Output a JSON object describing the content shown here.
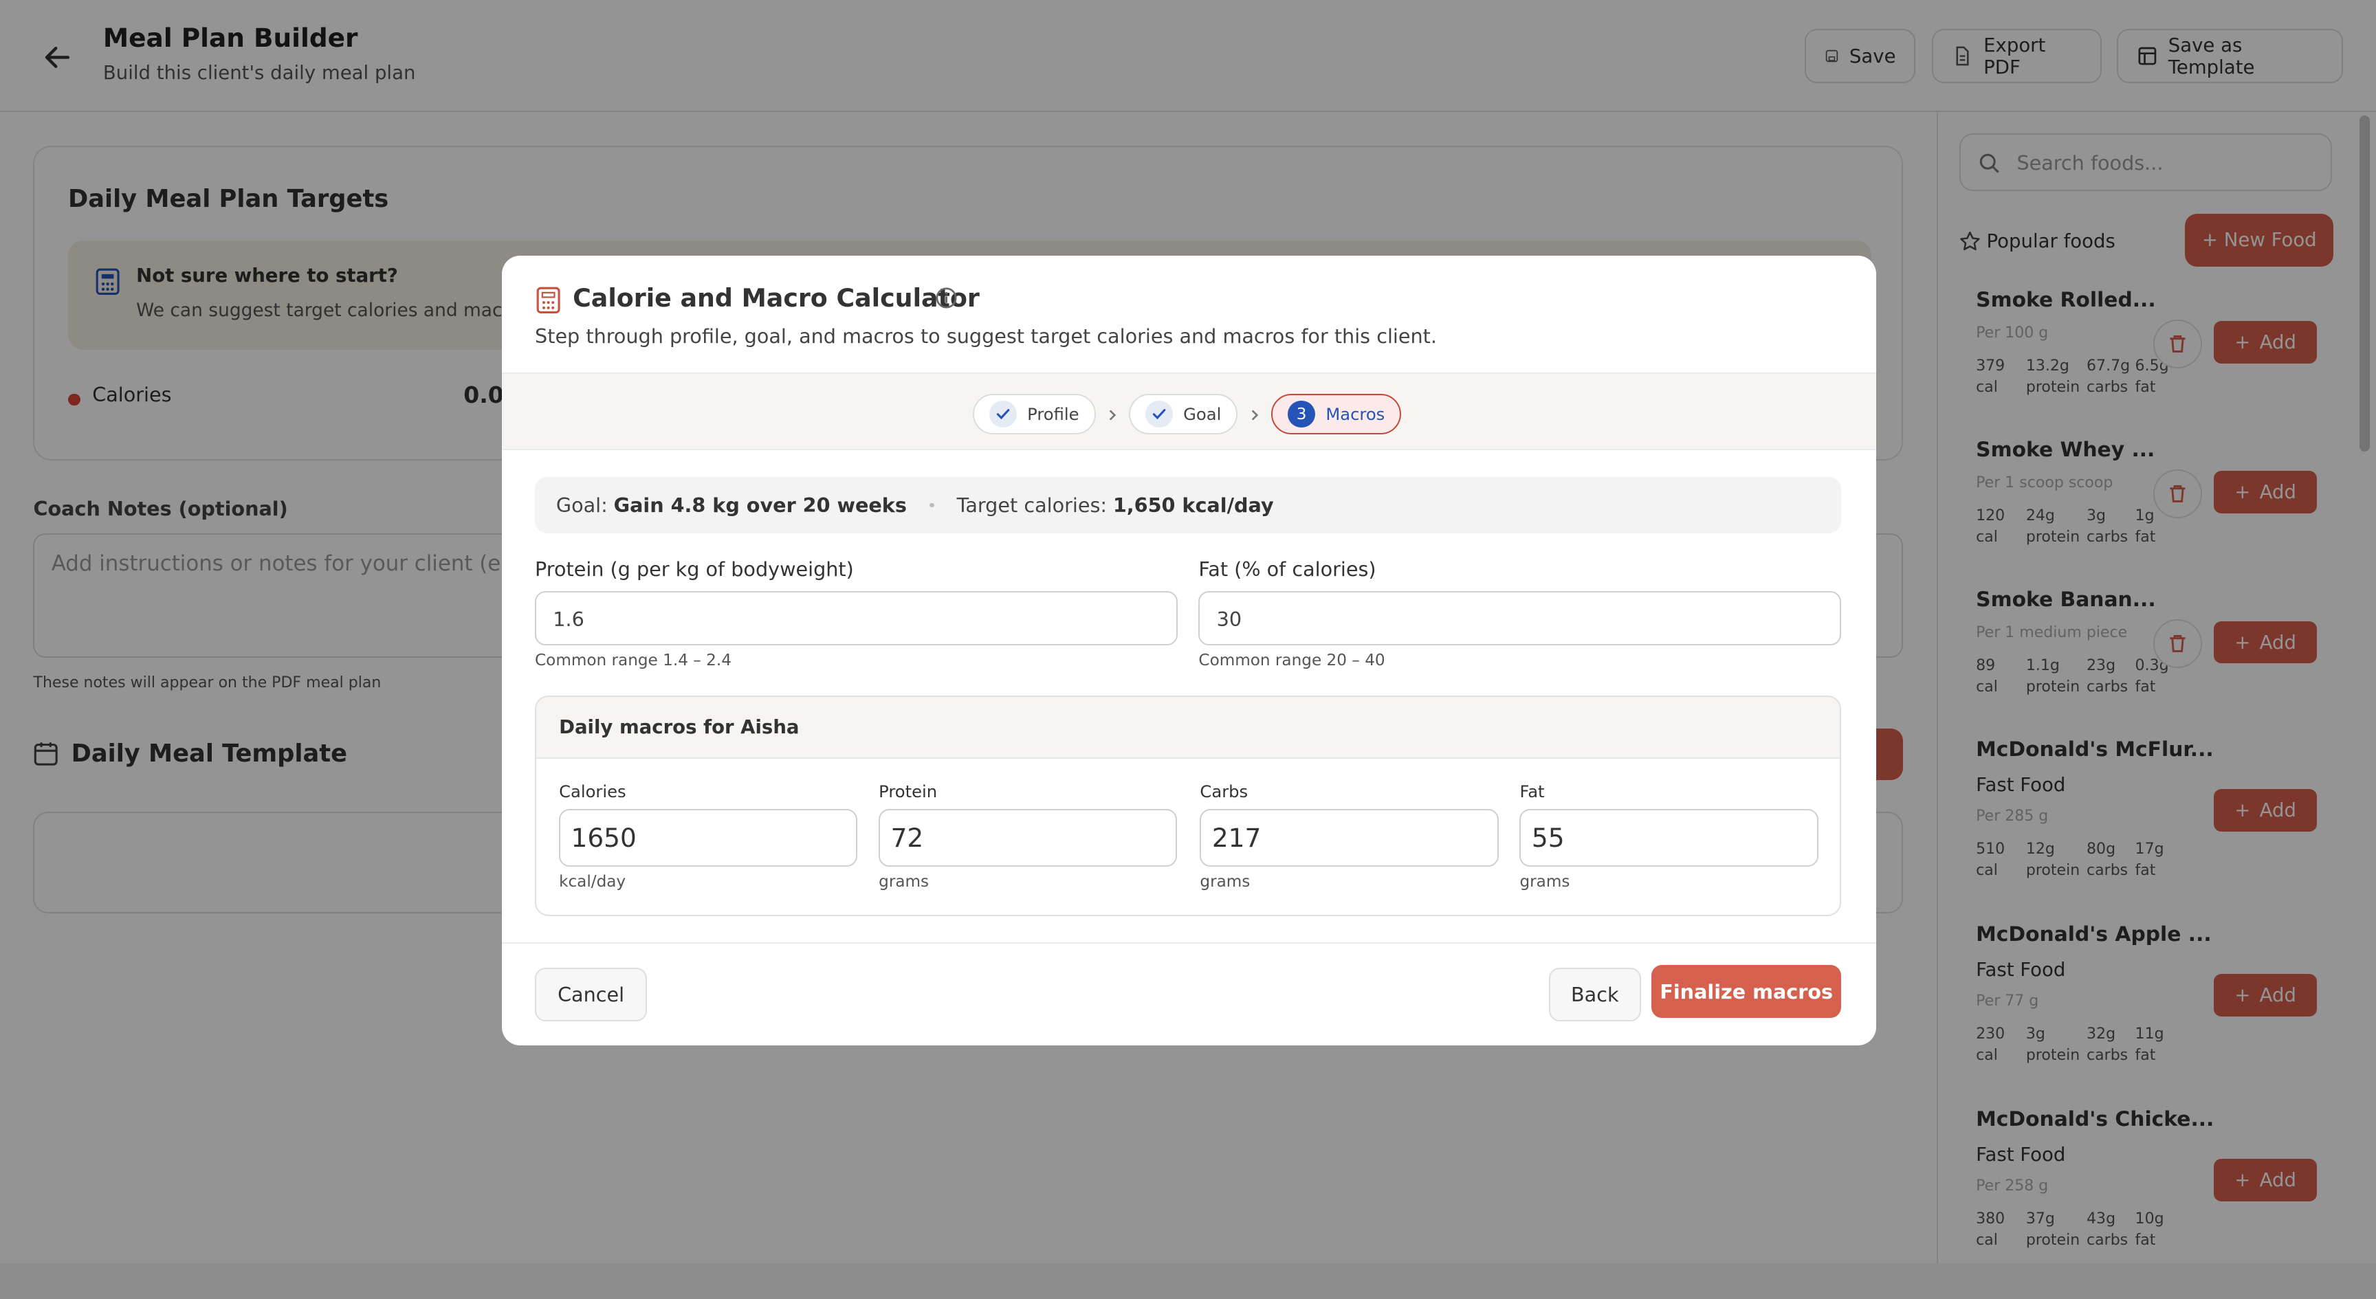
{
  "header": {
    "title": "Meal Plan Builder",
    "subtitle": "Build this client's daily meal plan",
    "save_label": "Save",
    "export_label": "Export PDF",
    "template_label": "Save as Template"
  },
  "targets": {
    "title": "Daily Meal Plan Targets",
    "hint_title": "Not sure where to start?",
    "hint_text": "We can suggest target calories and macr",
    "calories_label": "Calories",
    "calories_value": "0.0"
  },
  "notes": {
    "label": "Coach Notes (optional)",
    "placeholder": "Add instructions or notes for your client (e.g",
    "help": "These notes will appear on the PDF meal plan"
  },
  "template": {
    "title": "Daily Meal Template"
  },
  "foods": {
    "search_placeholder": "Search foods...",
    "popular_label": "Popular foods",
    "new_food_label": "+ New Food",
    "add_label": "Add",
    "items": [
      {
        "name": "Smoke Rolled...",
        "category": "",
        "serving": "Per 100 g",
        "cal": "379",
        "protein": "13.2g",
        "carbs": "67.7g",
        "fat": "6.5g"
      },
      {
        "name": "Smoke Whey ...",
        "category": "",
        "serving": "Per 1 scoop scoop",
        "cal": "120",
        "protein": "24g",
        "carbs": "3g",
        "fat": "1g"
      },
      {
        "name": "Smoke Banan...",
        "category": "",
        "serving": "Per 1 medium piece",
        "cal": "89",
        "protein": "1.1g",
        "carbs": "23g",
        "fat": "0.3g"
      },
      {
        "name": "McDonald's McFlur...",
        "category": "Fast Food",
        "serving": "Per 285 g",
        "cal": "510",
        "protein": "12g",
        "carbs": "80g",
        "fat": "17g"
      },
      {
        "name": "McDonald's Apple ...",
        "category": "Fast Food",
        "serving": "Per 77 g",
        "cal": "230",
        "protein": "3g",
        "carbs": "32g",
        "fat": "11g"
      },
      {
        "name": "McDonald's Chicke...",
        "category": "Fast Food",
        "serving": "Per 258 g",
        "cal": "380",
        "protein": "37g",
        "carbs": "43g",
        "fat": "10g"
      }
    ],
    "unit_cal": "cal",
    "unit_protein": "protein",
    "unit_carbs": "carbs",
    "unit_fat": "fat"
  },
  "modal": {
    "title": "Calorie and Macro Calculator",
    "subtitle": "Step through profile, goal, and macros to suggest target calories and macros for this client.",
    "steps": [
      {
        "label": "Profile",
        "state": "done"
      },
      {
        "label": "Goal",
        "state": "done"
      },
      {
        "label": "Macros",
        "number": "3",
        "state": "active"
      }
    ],
    "goal_label": "Goal:",
    "goal_value": "Gain 4.8 kg over 20 weeks",
    "target_label": "Target calories:",
    "target_value": "1,650 kcal/day",
    "protein_label": "Protein (g per kg of bodyweight)",
    "protein_value": "1.6",
    "protein_hint": "Common range 1.4 – 2.4",
    "fat_label": "Fat (% of calories)",
    "fat_value": "30",
    "fat_hint": "Common range 20 – 40",
    "macros_heading": "Daily macros for Aisha",
    "macros": [
      {
        "label": "Calories",
        "value": "1650",
        "unit": "kcal/day"
      },
      {
        "label": "Protein",
        "value": "72",
        "unit": "grams"
      },
      {
        "label": "Carbs",
        "value": "217",
        "unit": "grams"
      },
      {
        "label": "Fat",
        "value": "55",
        "unit": "grams"
      }
    ],
    "cancel_label": "Cancel",
    "back_label": "Back",
    "finalize_label": "Finalize macros"
  },
  "colors": {
    "accent": "#d6604e",
    "active_step": "#2553b8"
  }
}
